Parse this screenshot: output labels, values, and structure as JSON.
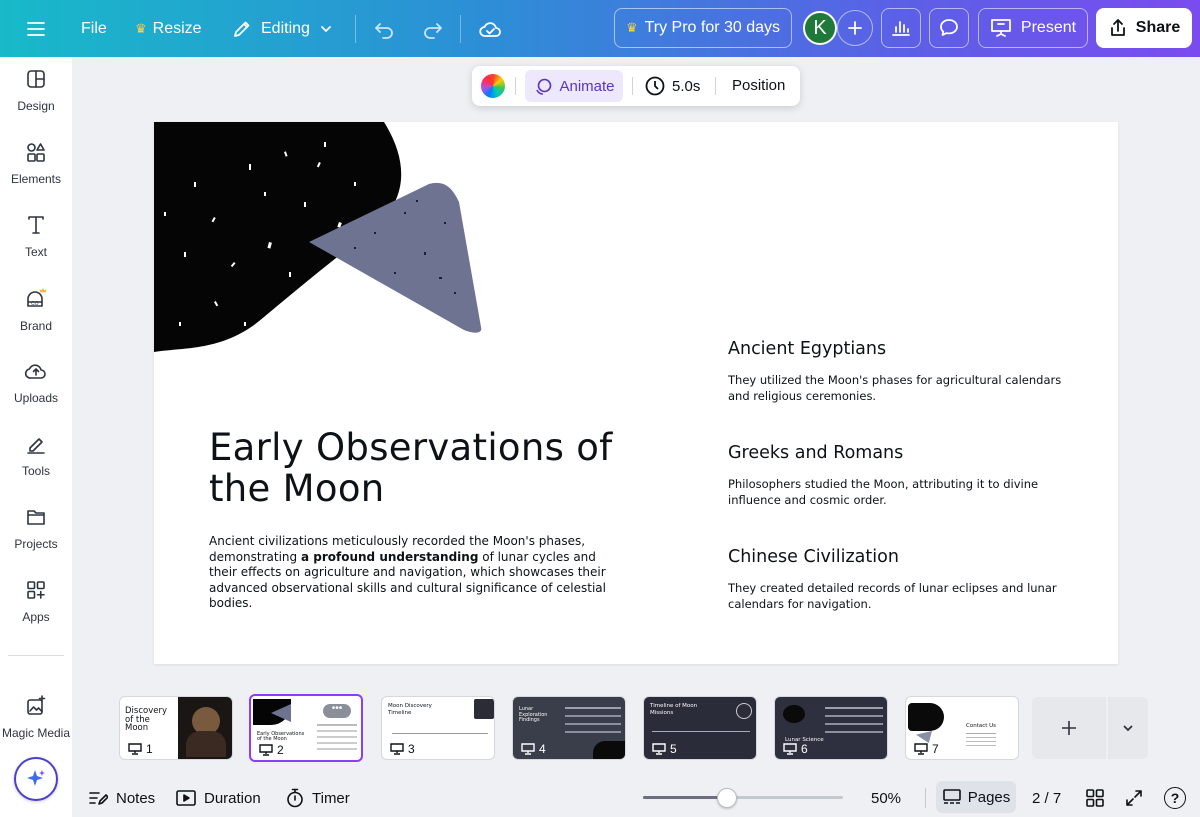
{
  "toolbar": {
    "file": "File",
    "resize": "Resize",
    "editing": "Editing",
    "try_pro": "Try Pro for 30 days",
    "avatar_initial": "K",
    "present": "Present",
    "share": "Share"
  },
  "sidebar": {
    "items": [
      {
        "label": "Design",
        "icon": "design-icon"
      },
      {
        "label": "Elements",
        "icon": "elements-icon"
      },
      {
        "label": "Text",
        "icon": "text-icon"
      },
      {
        "label": "Brand",
        "icon": "brand-icon"
      },
      {
        "label": "Uploads",
        "icon": "uploads-icon"
      },
      {
        "label": "Tools",
        "icon": "tools-icon"
      },
      {
        "label": "Projects",
        "icon": "projects-icon"
      },
      {
        "label": "Apps",
        "icon": "apps-icon"
      },
      {
        "label": "Magic Media",
        "icon": "magic-media-icon"
      }
    ]
  },
  "floating_toolbar": {
    "animate": "Animate",
    "duration": "5.0s",
    "position": "Position"
  },
  "slide": {
    "title": "Early Observations of the Moon",
    "body_before": "Ancient civilizations meticulously recorded the Moon's phases, demonstrating ",
    "body_bold": "a profound understanding",
    "body_after": " of lunar cycles and their effects on agriculture and navigation, which showcases their advanced observational skills and cultural significance of celestial bodies.",
    "sections": [
      {
        "heading": "Ancient Egyptians",
        "text": "They utilized the Moon's phases for agricultural calendars and religious ceremonies."
      },
      {
        "heading": "Greeks and Romans",
        "text": "Philosophers studied the Moon, attributing it to divine influence and cosmic order."
      },
      {
        "heading": "Chinese Civilization",
        "text": "They created detailed records of lunar eclipses and lunar calendars for navigation."
      }
    ]
  },
  "thumbnails": [
    {
      "num": "1",
      "title": "Discovery of the Moon",
      "dark": false
    },
    {
      "num": "2",
      "title": "Early Observations of the Moon",
      "dark": false
    },
    {
      "num": "3",
      "title": "Moon Discovery Timeline",
      "dark": false
    },
    {
      "num": "4",
      "title": "Lunar Exploration Findings",
      "dark": true
    },
    {
      "num": "5",
      "title": "Timeline of Moon Missions",
      "dark": true
    },
    {
      "num": "6",
      "title": "Lunar Science",
      "dark": true
    },
    {
      "num": "7",
      "title": "Contact Us",
      "dark": false
    }
  ],
  "bottombar": {
    "notes": "Notes",
    "duration": "Duration",
    "timer": "Timer",
    "zoom": "50%",
    "zoom_fraction": 0.42,
    "pages": "Pages",
    "page_indicator": "2 / 7",
    "help": "?"
  },
  "colors": {
    "accent": "#8b3dff",
    "animate": "#5a33c7",
    "avatar": "#1f7a3a"
  }
}
